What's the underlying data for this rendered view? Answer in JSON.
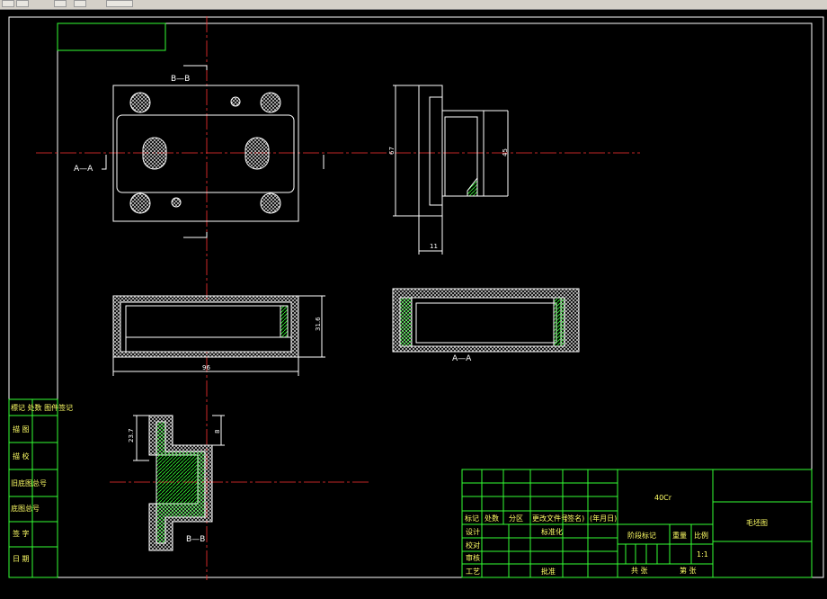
{
  "toolbar": {
    "buttons": [
      "save-icon",
      "open-icon",
      "undo-icon",
      "properties-icon"
    ]
  },
  "drawing": {
    "section_bb_label": "B—B",
    "section_aa_label": "A—A",
    "section_aa_label_2": "A—A",
    "section_bb_label_2": "B—B",
    "dim_height_side": "67",
    "dim_height_side_2": "45",
    "dim_width_side": "11",
    "dim_width_bottom": "96",
    "dim_height_bottom": "31.6",
    "dim_bb_height": "23.7",
    "dim_bb_small": "8"
  },
  "left_strip": {
    "rows": [
      "標记 处数 图件签记",
      "描 图",
      "描 校",
      "旧底图总号",
      "底图总号",
      "签 字",
      "日 期"
    ]
  },
  "title_block": {
    "material": "40Cr",
    "drawing_name": "毛坯图",
    "stage_label": "阶段标记",
    "weight_label": "重量",
    "scale_label": "比例",
    "scale_value": "1:1",
    "sheets_total": "共 张",
    "sheet_no": "第 张",
    "header_cols": [
      "标记",
      "处数",
      "分区",
      "更改文件号",
      "(签名)",
      "(年月日)"
    ],
    "rows": [
      "设计",
      "校对",
      "审核",
      "工艺"
    ],
    "std_label": "标准化",
    "approve_label": "批准"
  }
}
